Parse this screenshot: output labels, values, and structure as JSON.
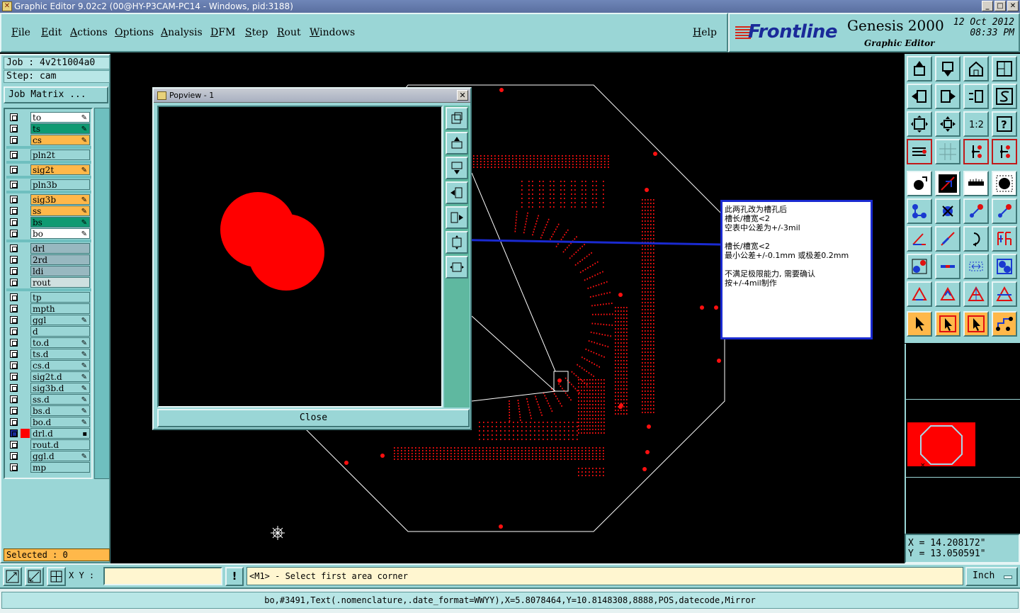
{
  "window": {
    "title": "Graphic Editor 9.02c2 (00@HY-P3CAM-PC14 - Windows, pid:3188)"
  },
  "menu": {
    "items": [
      "File",
      "Edit",
      "Actions",
      "Options",
      "Analysis",
      "DFM",
      "Step",
      "Rout",
      "Windows"
    ],
    "help": "Help"
  },
  "brand": {
    "logo": "Frontline",
    "product": "Genesis 2000",
    "subtitle": "Graphic Editor",
    "date": "12 Oct 2012",
    "time": "08:33 PM"
  },
  "job": {
    "job_label": "Job : 4v2t1004a0",
    "step_label": "Step: cam",
    "matrix_button": "Job Matrix ..."
  },
  "layers": [
    {
      "name": "to",
      "color": "#ffffff",
      "flag": true
    },
    {
      "name": "ts",
      "color": "#0f9a72",
      "flag": true
    },
    {
      "name": "cs",
      "color": "#ffb84a",
      "flag": true
    },
    {
      "name": "pln2t",
      "color": "#9ad6d6",
      "flag": false
    },
    {
      "name": "sig2t",
      "color": "#ffb84a",
      "flag": true
    },
    {
      "name": "pln3b",
      "color": "#9ad6d6",
      "flag": false
    },
    {
      "name": "sig3b",
      "color": "#ffb84a",
      "flag": true
    },
    {
      "name": "ss",
      "color": "#ffb84a",
      "flag": true
    },
    {
      "name": "bs",
      "color": "#0f9a72",
      "flag": true
    },
    {
      "name": "bo",
      "color": "#ffffff",
      "flag": true
    },
    {
      "name": "drl",
      "color": "#98b8c0",
      "flag": false
    },
    {
      "name": "2rd",
      "color": "#98b8c0",
      "flag": false
    },
    {
      "name": "ldi",
      "color": "#98b8c0",
      "flag": false
    },
    {
      "name": "rout",
      "color": "#cfe0e0",
      "flag": false
    },
    {
      "name": "tp",
      "color": "#9ad6d6",
      "flag": false
    },
    {
      "name": "mpth",
      "color": "#9ad6d6",
      "flag": false
    },
    {
      "name": "ggl",
      "color": "#9ad6d6",
      "flag": true
    },
    {
      "name": "d",
      "color": "#9ad6d6",
      "flag": false
    },
    {
      "name": "to.d",
      "color": "#9ad6d6",
      "flag": true
    },
    {
      "name": "ts.d",
      "color": "#9ad6d6",
      "flag": true
    },
    {
      "name": "cs.d",
      "color": "#9ad6d6",
      "flag": true
    },
    {
      "name": "sig2t.d",
      "color": "#9ad6d6",
      "flag": true
    },
    {
      "name": "sig3b.d",
      "color": "#9ad6d6",
      "flag": true
    },
    {
      "name": "ss.d",
      "color": "#9ad6d6",
      "flag": true
    },
    {
      "name": "bs.d",
      "color": "#9ad6d6",
      "flag": true
    },
    {
      "name": "bo.d",
      "color": "#9ad6d6",
      "flag": true
    },
    {
      "name": "drl.d",
      "color": "#9ad6d6",
      "flag": true,
      "active": true
    },
    {
      "name": "rout.d",
      "color": "#9ad6d6",
      "flag": false
    },
    {
      "name": "ggl.d",
      "color": "#9ad6d6",
      "flag": true
    },
    {
      "name": "mp",
      "color": "#9ad6d6",
      "flag": false
    }
  ],
  "selected": "Selected : 0",
  "popview": {
    "title": "Popview - 1",
    "close_label": "Close"
  },
  "annotation": {
    "lines": [
      "此两孔改为槽孔后",
      "槽长/槽宽<2",
      "空表中公差为+/-3mil",
      "",
      "槽长/槽宽<2",
      "最小公差+/-0.1mm 或极差0.2mm",
      "",
      "不满足极限能力, 需要确认",
      "按+/-4mil制作"
    ]
  },
  "coords": {
    "x": "X = 14.208172\"",
    "y": "Y = 13.050591\""
  },
  "bottom": {
    "xy_label": "X Y :",
    "xy_value": "",
    "alert": "!",
    "prompt": "<M1> - Select first area corner",
    "units": "Inch"
  },
  "status": "bo,#3491,Text(.nomenclature,.date_format=WWYY),X=5.8078464,Y=10.8148308,8888,POS,datecode,Mirror",
  "colors": {
    "panel": "#9ad6d6",
    "accent": "#ffb84a",
    "pad": "#ff0000",
    "leader": "#1a2ad0"
  }
}
